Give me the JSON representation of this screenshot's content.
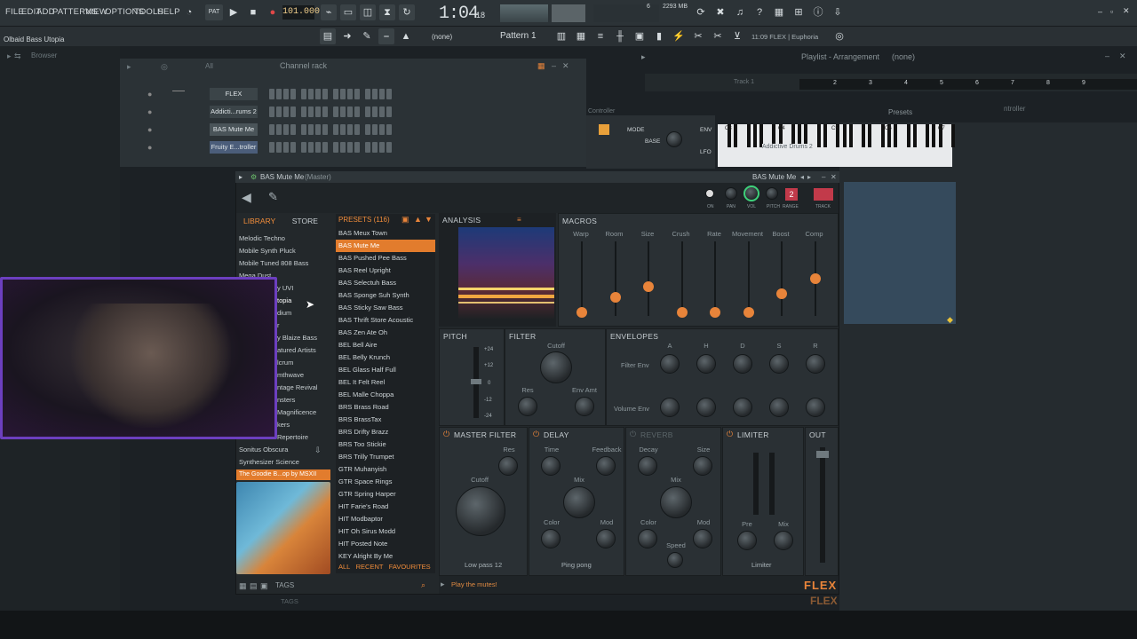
{
  "menu": [
    "FILE",
    "EDIT",
    "ADD",
    "PATTERNS",
    "VIEW",
    "OPTIONS",
    "TOOLS",
    "HELP"
  ],
  "transport": {
    "tempo": "101.000",
    "time": "1:04",
    "time_small": "18",
    "pattern": "Pattern 1",
    "mem": "2293 MB",
    "cpu": "6",
    "hint_text": "11:09 FLEX | Euphoria",
    "snap": "(none)"
  },
  "window_title": "Olbaid Bass Utopia",
  "browser_label": "Browser",
  "channel_rack": {
    "title": "Channel rack",
    "filter": "All",
    "channels": [
      "FLEX",
      "Addicti...rums 2",
      "BAS Mute Me",
      "Fruity E...troller"
    ]
  },
  "playlist": {
    "title": "Playlist - Arrangement",
    "pattern": "(none)",
    "track": "Track 1",
    "ruler": [
      "2",
      "3",
      "4",
      "5",
      "6",
      "7",
      "8",
      "9"
    ],
    "controller": "Controller",
    "presets": "Presets",
    "controller2": "ntroller"
  },
  "piano_plugin": {
    "label": "Addictive Drums 2",
    "mode": "MODE",
    "base": "BASE",
    "env": "ENV",
    "lfo": "LFO",
    "keys": [
      "C3",
      "C4",
      "C5",
      "C6",
      "C7"
    ]
  },
  "flex": {
    "title": "BAS Mute Me",
    "title_suffix": "(Master)",
    "tabs": [
      "LIBRARY",
      "STORE"
    ],
    "presets_header": "PRESETS (116)",
    "categories": [
      "Melodic Techno",
      "Mobile Synth Pluck",
      "Mobile Tuned 808 Bass",
      "Mega Dust",
      "y UVI",
      "topia",
      "dium",
      "r",
      "y Blaize Bass",
      "atured Artists",
      "lcrum",
      "mthwave",
      "ntage Revival",
      "nsters",
      "Magnificence",
      "kers",
      "Repertoire",
      "Sonitus Obscura",
      "Synthesizer Science"
    ],
    "active_category": "The Goodie B...op by MSXII",
    "presets": [
      "BAS Meux Town",
      "BAS Mute Me",
      "BAS Pushed Pee Bass",
      "BAS Reel Upright",
      "BAS Selectuh Bass",
      "BAS Sponge Suh Synth",
      "BAS Sticky Saw Bass",
      "BAS Thrift Store Acoustic",
      "BAS Zen Ate Oh",
      "BEL Bell Aire",
      "BEL Belly Krunch",
      "BEL Glass Half Full",
      "BEL It Felt Reel",
      "BEL Malle Choppa",
      "BRS Brass Road",
      "BRS BrassTax",
      "BRS Drifty Brazz",
      "BRS Too Stickie",
      "BRS Trilly Trumpet",
      "GTR Muhanyish",
      "GTR Space Rings",
      "GTR Spring Harper",
      "HIT Farie's Road",
      "HIT Modbaptor",
      "HIT Oh Sirus Modd",
      "HIT Posted Note",
      "KEY Alright By Me"
    ],
    "preset_footer": [
      "ALL",
      "RECENT",
      "FAVOURITES"
    ],
    "head_controls": [
      "ON",
      "PAN",
      "VOL",
      "PITCH",
      "RANGE",
      "TRACK"
    ],
    "pitch_range": "2",
    "sections": {
      "analysis": "ANALYSIS",
      "macros": "MACROS",
      "pitch": "PITCH",
      "filter": "FILTER",
      "envelopes": "ENVELOPES",
      "master_filter": "MASTER FILTER",
      "delay": "DELAY",
      "reverb": "REVERB",
      "limiter": "LIMITER",
      "out": "OUT"
    },
    "macros": [
      "Warp",
      "Room",
      "Size",
      "Crush",
      "Rate",
      "Movement",
      "Boost",
      "Comp"
    ],
    "macro_values": [
      0.0,
      0.2,
      0.35,
      0.0,
      0.0,
      0.0,
      0.25,
      0.45
    ],
    "pitch_scale": [
      "+24",
      "+12",
      "0",
      "-12",
      "-24"
    ],
    "filter_labels": [
      "Cutoff",
      "Res",
      "Env Amt"
    ],
    "env_cols": [
      "A",
      "H",
      "D",
      "S",
      "R"
    ],
    "env_rows": [
      "Filter Env",
      "Volume Env"
    ],
    "mfilter_labels": [
      "Res",
      "Cutoff"
    ],
    "mfilter_mode": "Low pass 12",
    "delay_labels": [
      "Time",
      "Feedback",
      "Mix",
      "Color",
      "Mod"
    ],
    "delay_mode": "Ping pong",
    "reverb_labels": [
      "Decay",
      "Size",
      "Mix",
      "Color",
      "Mod",
      "Speed"
    ],
    "limiter_labels": [
      "Pre",
      "Mix"
    ],
    "limiter_mode": "Limiter",
    "footer_msg": "Play the mutes!",
    "logo": "FLEX",
    "tags": "TAGS"
  },
  "colors": {
    "accent": "#e8843a",
    "bg": "#1c2125",
    "panel": "#2a3034",
    "webcam_border": "#6c3fbf"
  }
}
